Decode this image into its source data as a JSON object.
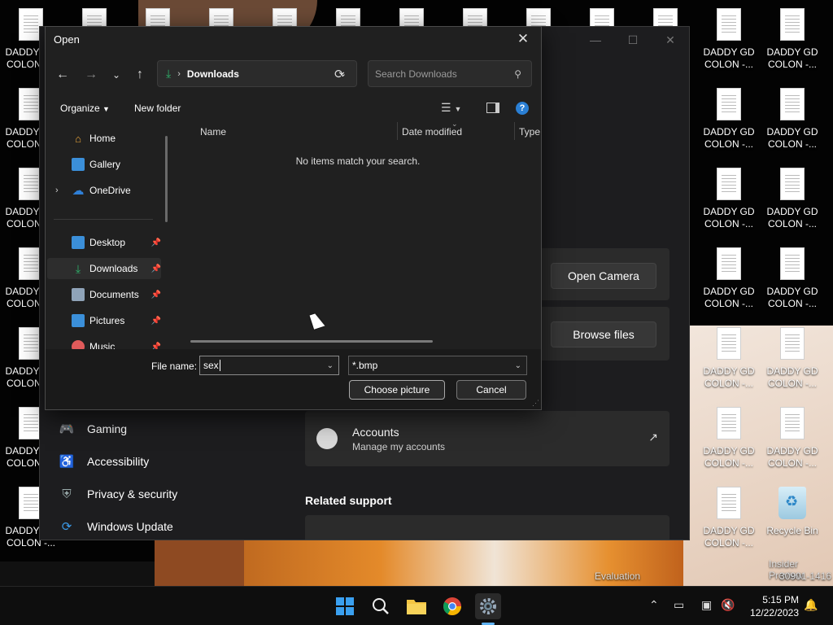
{
  "desktop": {
    "file_label": "DADDY GD\nCOLON -...",
    "recycle_label": "Recycle Bin",
    "watermark_line1": "Insider Preview",
    "watermark_line2": "30901-1416",
    "watermark_eval": "Evaluation"
  },
  "settings": {
    "open_camera": "Open Camera",
    "browse_files": "Browse files",
    "accounts_title": "Accounts",
    "accounts_sub": "Manage my accounts",
    "related": "Related support",
    "nav": [
      {
        "label": "Gaming",
        "icon": "gamepad-icon"
      },
      {
        "label": "Accessibility",
        "icon": "accessibility-icon"
      },
      {
        "label": "Privacy & security",
        "icon": "shield-icon"
      },
      {
        "label": "Windows Update",
        "icon": "update-icon"
      }
    ]
  },
  "dialog": {
    "title": "Open",
    "address": "Downloads",
    "search_placeholder": "Search Downloads",
    "organize": "Organize",
    "new_folder": "New folder",
    "tree": [
      {
        "label": "Home",
        "color": "#e8a33a"
      },
      {
        "label": "Gallery",
        "color": "#3b8fd9"
      },
      {
        "label": "OneDrive",
        "color": "#2f7fd6"
      },
      {
        "label": "Desktop",
        "color": "#3b8fd9"
      },
      {
        "label": "Downloads",
        "color": "#2fb36b"
      },
      {
        "label": "Documents",
        "color": "#8fa3b8"
      },
      {
        "label": "Pictures",
        "color": "#3b8fd9"
      },
      {
        "label": "Music",
        "color": "#e05a5a"
      }
    ],
    "columns": {
      "name": "Name",
      "date": "Date modified",
      "type": "Type"
    },
    "empty_message": "No items match your search.",
    "file_name_label": "File name:",
    "file_name_value": "sex",
    "file_type": "*.bmp",
    "choose_button": "Choose picture",
    "cancel_button": "Cancel"
  },
  "taskbar": {
    "time": "5:15 PM",
    "date": "12/22/2023",
    "apps": [
      "start-icon",
      "search-icon",
      "file-explorer-icon",
      "chrome-icon",
      "settings-icon"
    ]
  }
}
